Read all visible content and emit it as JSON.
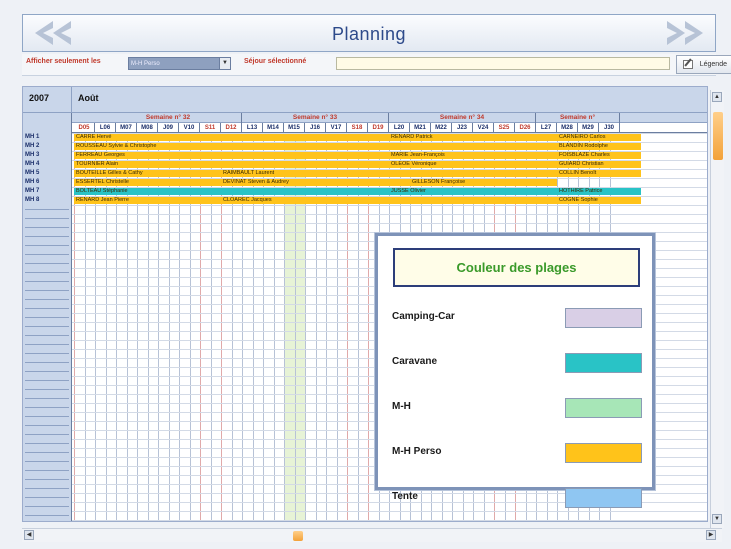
{
  "window": {
    "title": "Planning",
    "prev_icon": "double-chevron-left-icon",
    "next_icon": "double-chevron-right-icon"
  },
  "filters": {
    "show_only_label": "Afficher seulement les",
    "show_only_value": "M-H Perso",
    "selected_stay_label": "Séjour sélectionné",
    "selected_stay_value": "",
    "legend_button_label": "Légende"
  },
  "planning": {
    "year": "2007",
    "month": "Août",
    "weeks": [
      "Semaine n° 32",
      "Semaine n° 33",
      "Semaine n° 34",
      "Semaine n°"
    ],
    "days": [
      "D05",
      "L06",
      "M07",
      "M08",
      "J09",
      "V10",
      "S11",
      "D12",
      "L13",
      "M14",
      "M15",
      "J16",
      "V17",
      "S18",
      "D19",
      "L20",
      "M21",
      "M22",
      "J23",
      "V24",
      "S25",
      "D26",
      "L27",
      "M28",
      "M29",
      "J30"
    ],
    "units": [
      "MH 1",
      "MH 2",
      "MH 3",
      "MH 4",
      "MH 5",
      "MH 6",
      "MH 7",
      "MH 8"
    ],
    "bookings": [
      {
        "row": 0,
        "start": 0,
        "span": 15,
        "name": "CARRE Hervé",
        "type": "mh_perso"
      },
      {
        "row": 0,
        "start": 15,
        "span": 8,
        "name": "RENARD Patrick",
        "type": "mh_perso"
      },
      {
        "row": 0,
        "start": 23,
        "span": 4,
        "name": "CARNEIRO Carlos",
        "type": "mh_perso"
      },
      {
        "row": 1,
        "start": 0,
        "span": 23,
        "name": "ROUSSEAU Sylvie & Christophe",
        "type": "mh_perso"
      },
      {
        "row": 1,
        "start": 23,
        "span": 4,
        "name": "BLANDIN Rodolphe",
        "type": "mh_perso"
      },
      {
        "row": 2,
        "start": 0,
        "span": 15,
        "name": "FERREAU Georges",
        "type": "mh_perso"
      },
      {
        "row": 2,
        "start": 15,
        "span": 8,
        "name": "MARIE Jean-François",
        "type": "mh_perso"
      },
      {
        "row": 2,
        "start": 23,
        "span": 4,
        "name": "FOISBLAZE Charles",
        "type": "mh_perso"
      },
      {
        "row": 3,
        "start": 0,
        "span": 15,
        "name": "TOURNIER Alain",
        "type": "mh_perso"
      },
      {
        "row": 3,
        "start": 15,
        "span": 8,
        "name": "OLEOE Véronique",
        "type": "mh_perso"
      },
      {
        "row": 3,
        "start": 23,
        "span": 4,
        "name": "GUIARD Christian",
        "type": "mh_perso"
      },
      {
        "row": 4,
        "start": 0,
        "span": 7,
        "name": "BOUTEILLE Gilles & Cathy",
        "type": "mh_perso"
      },
      {
        "row": 4,
        "start": 7,
        "span": 16,
        "name": "RAIMBAULT Laurent",
        "type": "mh_perso"
      },
      {
        "row": 4,
        "start": 23,
        "span": 4,
        "name": "COLLIN Benoît",
        "type": "mh_perso"
      },
      {
        "row": 5,
        "start": 0,
        "span": 7,
        "name": "ESSERTEL Christelle",
        "type": "mh_perso"
      },
      {
        "row": 5,
        "start": 7,
        "span": 9,
        "name": "DEVINAT Steven & Audrey",
        "type": "mh_perso"
      },
      {
        "row": 5,
        "start": 16,
        "span": 7,
        "name": "GILLESON Françoise",
        "type": "mh_perso"
      },
      {
        "row": 6,
        "start": 0,
        "span": 15,
        "name": "BOLTEAU Stéphanie",
        "type": "caravane"
      },
      {
        "row": 6,
        "start": 15,
        "span": 8,
        "name": "JUSSE Olivier",
        "type": "caravane"
      },
      {
        "row": 6,
        "start": 23,
        "span": 4,
        "name": "HOTHIRE Patrice",
        "type": "caravane"
      },
      {
        "row": 7,
        "start": 0,
        "span": 7,
        "name": "RENARD Jean Pierre",
        "type": "mh_perso"
      },
      {
        "row": 7,
        "start": 7,
        "span": 16,
        "name": "CLOAREC Jacques",
        "type": "mh_perso"
      },
      {
        "row": 7,
        "start": 23,
        "span": 4,
        "name": "COGNE Sophie",
        "type": "mh_perso"
      }
    ]
  },
  "legend": {
    "title": "Couleur des plages",
    "items": [
      {
        "label": "Camping-Car",
        "color": "#d9cfe6"
      },
      {
        "label": "Caravane",
        "color": "#29c3c6"
      },
      {
        "label": "M-H",
        "color": "#a7e6b7"
      },
      {
        "label": "M-H Perso",
        "color": "#ffc31a"
      },
      {
        "label": "Tente",
        "color": "#8fc6f2"
      }
    ]
  },
  "colors": {
    "mh_perso": "#ffc31a",
    "caravane": "#29c3c6",
    "accent": "#2d4a8a"
  }
}
